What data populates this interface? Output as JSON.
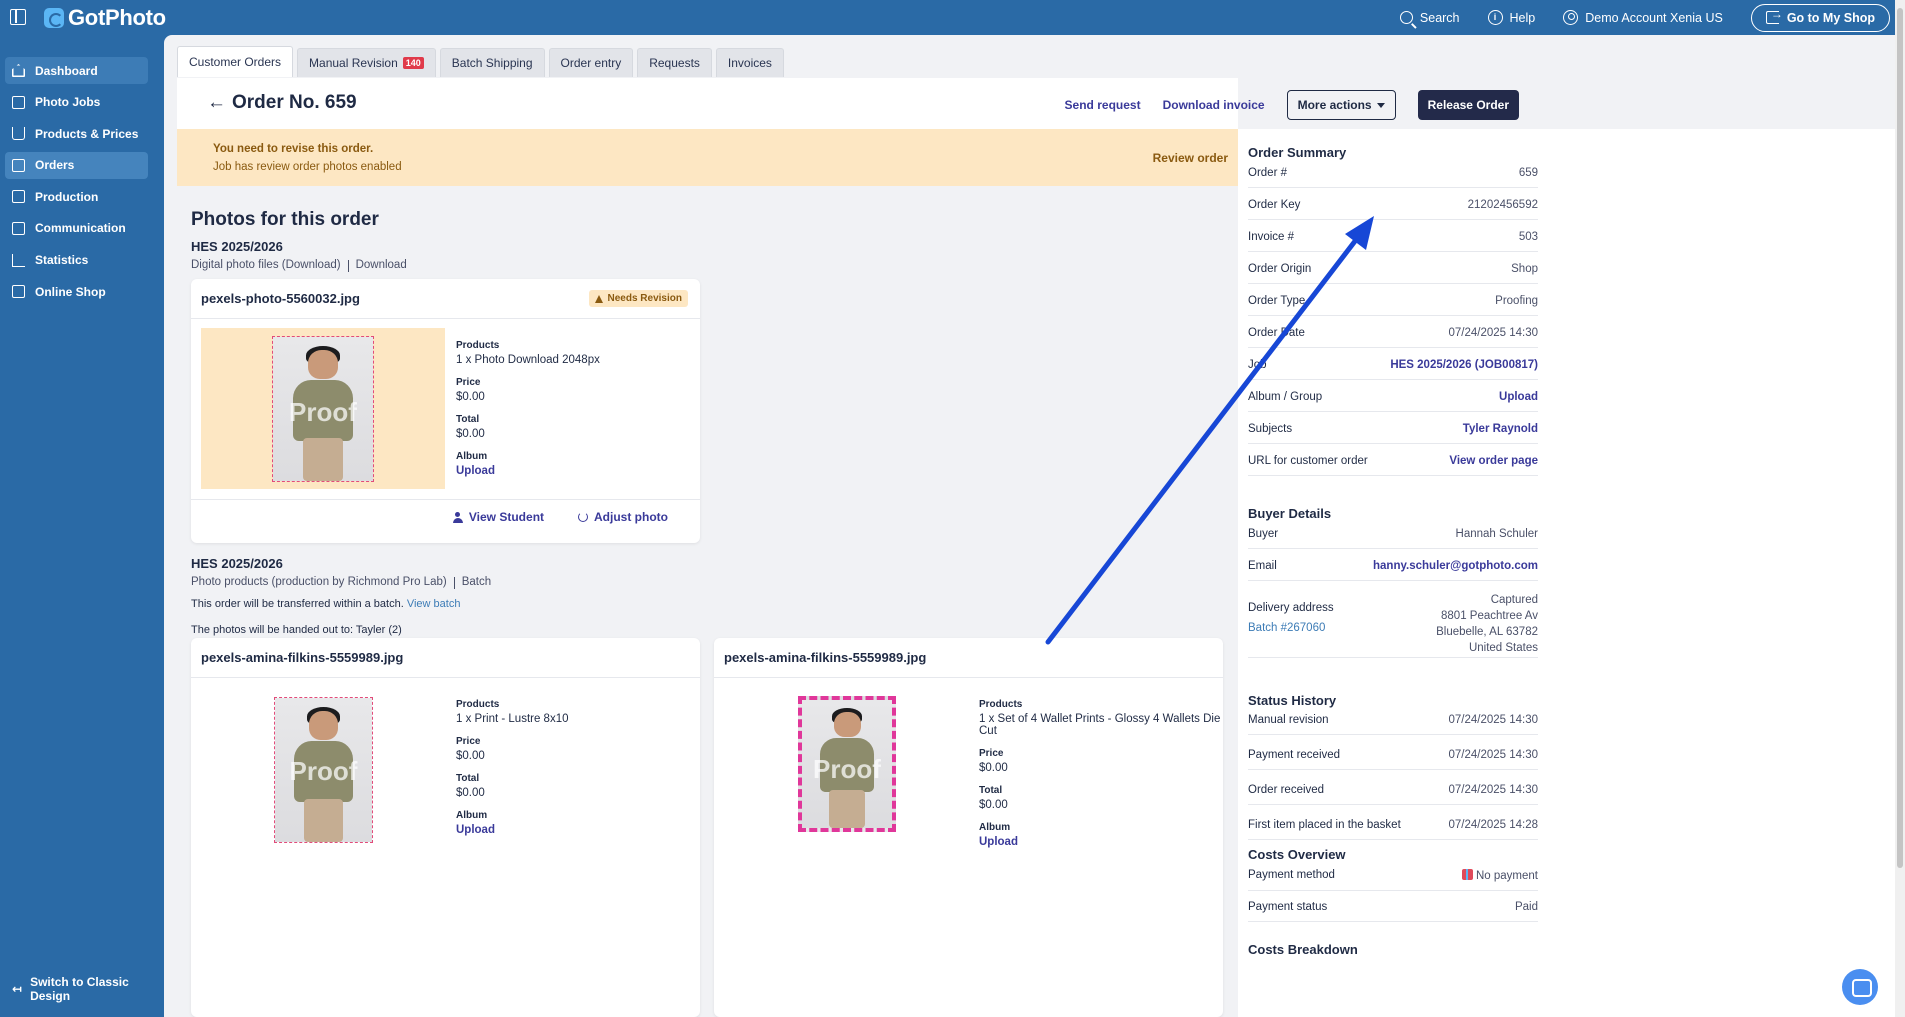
{
  "app": {
    "brand": "GotPhoto"
  },
  "topbar": {
    "search": "Search",
    "help": "Help",
    "account": "Demo Account Xenia US",
    "shop_button": "Go to My Shop"
  },
  "sidebar": {
    "items": [
      {
        "label": "Dashboard",
        "icon": "house-icon"
      },
      {
        "label": "Photo Jobs",
        "icon": "image-icon"
      },
      {
        "label": "Products & Prices",
        "icon": "cart-icon"
      },
      {
        "label": "Orders",
        "icon": "orders-icon"
      },
      {
        "label": "Production",
        "icon": "printer-icon"
      },
      {
        "label": "Communication",
        "icon": "message-icon"
      },
      {
        "label": "Statistics",
        "icon": "chart-icon"
      },
      {
        "label": "Online Shop",
        "icon": "store-icon"
      }
    ],
    "switch_label": "Switch to Classic Design"
  },
  "tabs": [
    {
      "label": "Customer Orders"
    },
    {
      "label": "Manual Revision",
      "badge": "140"
    },
    {
      "label": "Batch Shipping"
    },
    {
      "label": "Order entry"
    },
    {
      "label": "Requests"
    },
    {
      "label": "Invoices"
    }
  ],
  "order": {
    "title": "Order No. 659",
    "send_request": "Send request",
    "download_invoice": "Download invoice",
    "more_actions": "More actions",
    "release": "Release Order"
  },
  "alert": {
    "title": "You need to revise this order.",
    "detail": "Job has review order photos enabled",
    "action": "Review order"
  },
  "photos": {
    "title": "Photos for this order",
    "group1": {
      "job": "HES 2025/2026",
      "desc": "Digital photo files (Download)",
      "type": "Download",
      "card": {
        "file": "pexels-photo-5560032.jpg",
        "badge": "Needs Revision",
        "proof": "Proof",
        "products_label": "Products",
        "products": "1 x Photo Download 2048px",
        "price_label": "Price",
        "price": "$0.00",
        "total_label": "Total",
        "total": "$0.00",
        "album_label": "Album",
        "album": "Upload",
        "view_student": "View Student",
        "adjust_photo": "Adjust photo"
      }
    },
    "group2": {
      "job": "HES 2025/2026",
      "desc": "Photo products (production by Richmond Pro Lab)",
      "type": "Batch",
      "note1": "This order will be transferred within a batch.",
      "note1_link": "View batch",
      "note2": "The photos will be handed out to: Tayler (2)",
      "cards": [
        {
          "file": "pexels-amina-filkins-5559989.jpg",
          "proof": "Proof",
          "products_label": "Products",
          "products": "1 x Print - Lustre 8x10",
          "price_label": "Price",
          "price": "$0.00",
          "total_label": "Total",
          "total": "$0.00",
          "album_label": "Album",
          "album": "Upload"
        },
        {
          "file": "pexels-amina-filkins-5559989.jpg",
          "proof": "Proof",
          "products_label": "Products",
          "products": "1 x Set of 4 Wallet Prints - Glossy 4 Wallets Die Cut",
          "price_label": "Price",
          "price": "$0.00",
          "total_label": "Total",
          "total": "$0.00",
          "album_label": "Album",
          "album": "Upload"
        }
      ]
    }
  },
  "summary": {
    "title": "Order Summary",
    "rows": [
      {
        "k": "Order #",
        "v": "659"
      },
      {
        "k": "Order Key",
        "v": "21202456592"
      },
      {
        "k": "Invoice #",
        "v": "503"
      },
      {
        "k": "Order Origin",
        "v": "Shop"
      },
      {
        "k": "Order Type",
        "v": "Proofing"
      },
      {
        "k": "Order Date",
        "v": "07/24/2025 14:30"
      },
      {
        "k": "Job",
        "v": "HES 2025/2026 (JOB00817)"
      },
      {
        "k": "Album / Group",
        "v": "Upload"
      },
      {
        "k": "Subjects",
        "v": "Tyler Raynold"
      },
      {
        "k": "URL for customer order",
        "v": "View order page"
      }
    ],
    "buyer_title": "Buyer Details",
    "buyer": {
      "k": "Buyer",
      "v": "Hannah Schuler"
    },
    "email": {
      "k": "Email",
      "v": "hanny.schuler@gotphoto.com"
    },
    "delivery": {
      "k": "Delivery address",
      "batch": "Batch #267060",
      "lines": [
        "Captured",
        "8801 Peachtree Av",
        "Bluebelle, AL 63782",
        "United States"
      ]
    },
    "status_title": "Status History",
    "status": [
      {
        "k": "Manual revision",
        "v": "07/24/2025 14:30"
      },
      {
        "k": "Payment received",
        "v": "07/24/2025 14:30"
      },
      {
        "k": "Order received",
        "v": "07/24/2025 14:30"
      },
      {
        "k": "First item placed in the basket",
        "v": "07/24/2025 14:28"
      }
    ],
    "costs_title": "Costs Overview",
    "costs": [
      {
        "k": "Payment method",
        "v": "No payment"
      },
      {
        "k": "Payment status",
        "v": "Paid"
      }
    ],
    "breakdown_title": "Costs Breakdown"
  }
}
